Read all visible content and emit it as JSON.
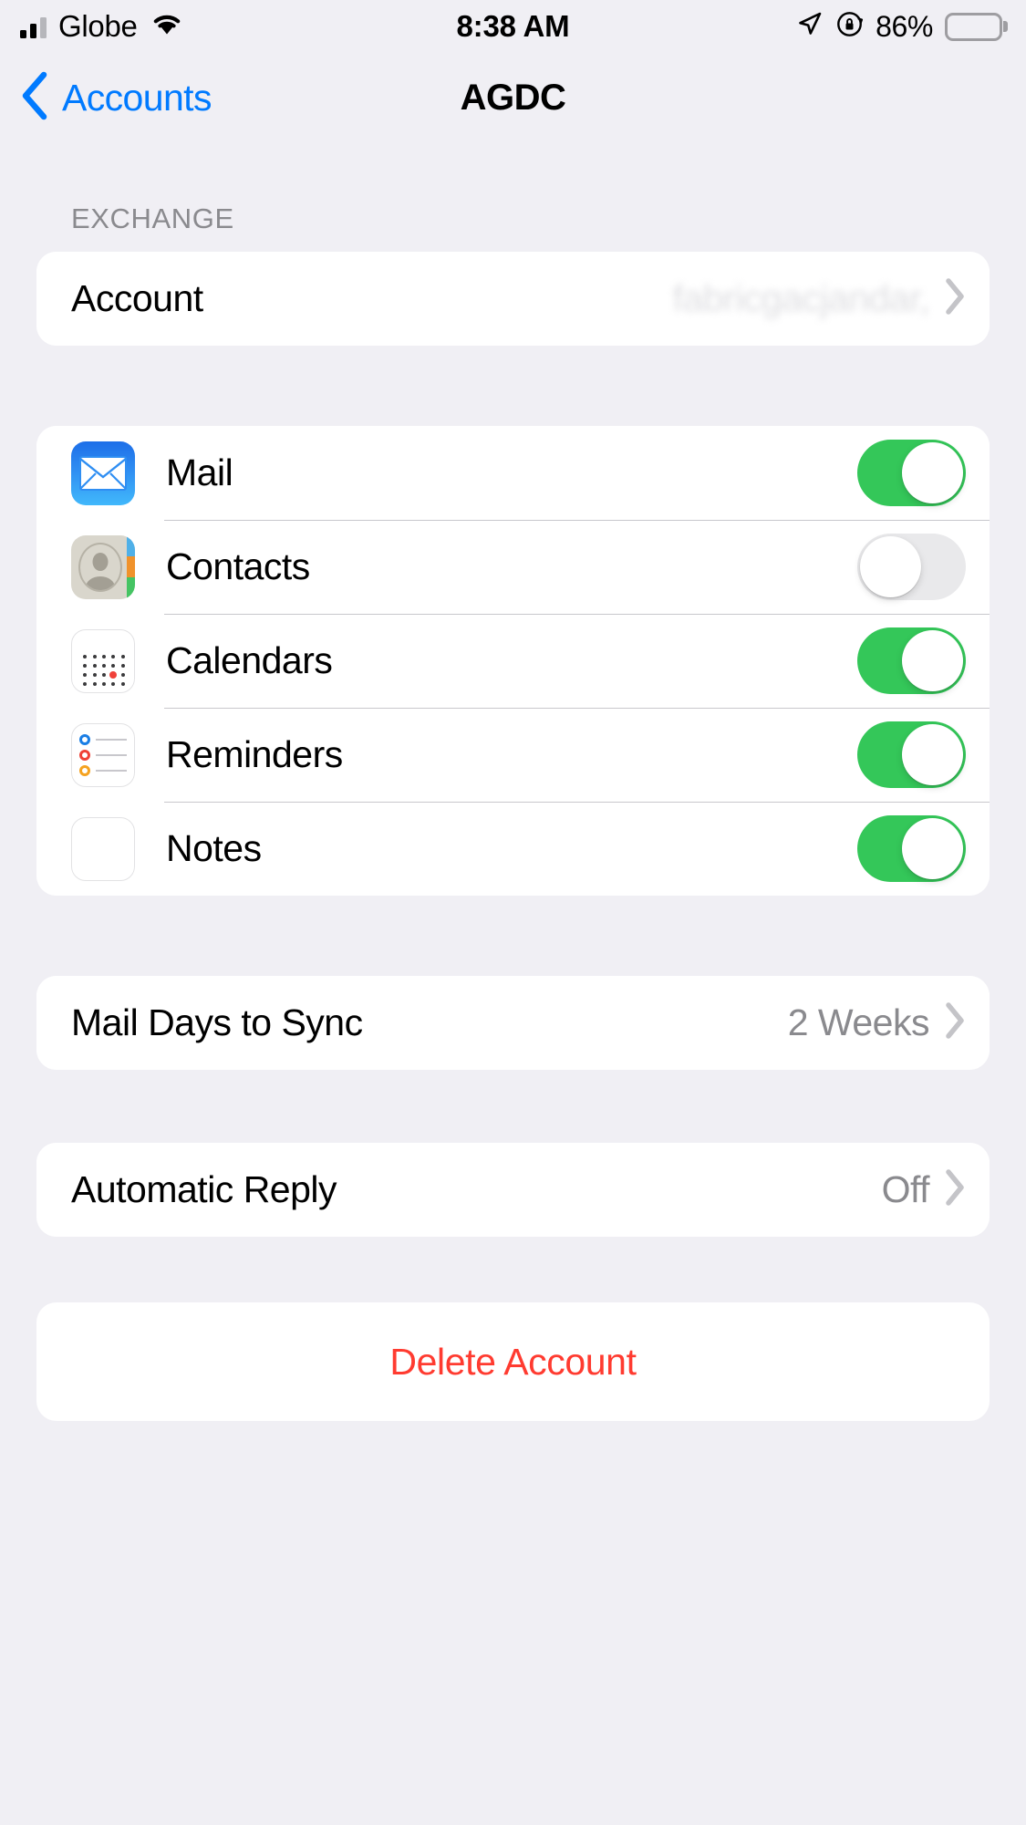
{
  "status_bar": {
    "carrier": "Globe",
    "time": "8:38 AM",
    "battery_percent": "86%",
    "icons": {
      "signal": "cellular-signal-icon",
      "wifi": "wifi-icon",
      "location": "location-arrow-icon",
      "rotation_lock": "rotation-lock-icon",
      "battery": "battery-icon"
    }
  },
  "nav_bar": {
    "back_label": "Accounts",
    "title": "AGDC",
    "back_icon": "chevron-left-icon"
  },
  "exchange_section": {
    "header": "EXCHANGE",
    "account_row": {
      "label": "Account",
      "value": "fabricgacjandar,",
      "chevron": "chevron-right-icon"
    }
  },
  "services_section": {
    "rows": [
      {
        "label": "Mail",
        "icon": "mail-app-icon",
        "enabled": true,
        "toggle_state": "on"
      },
      {
        "label": "Contacts",
        "icon": "contacts-app-icon",
        "enabled": false,
        "toggle_state": "off"
      },
      {
        "label": "Calendars",
        "icon": "calendars-app-icon",
        "enabled": true,
        "toggle_state": "on"
      },
      {
        "label": "Reminders",
        "icon": "reminders-app-icon",
        "enabled": true,
        "toggle_state": "on"
      },
      {
        "label": "Notes",
        "icon": "notes-app-icon",
        "enabled": true,
        "toggle_state": "on"
      }
    ]
  },
  "sync_section": {
    "label": "Mail Days to Sync",
    "value": "2 Weeks"
  },
  "reply_section": {
    "label": "Automatic Reply",
    "value": "Off"
  },
  "delete_section": {
    "label": "Delete Account"
  },
  "colors": {
    "accent_blue": "#007aff",
    "toggle_on_green": "#34c759",
    "toggle_off_gray": "#e9e9eb",
    "destructive_red": "#ff3b30",
    "background": "#f0eff4",
    "card": "#ffffff",
    "secondary_text": "#8a8a8e"
  }
}
